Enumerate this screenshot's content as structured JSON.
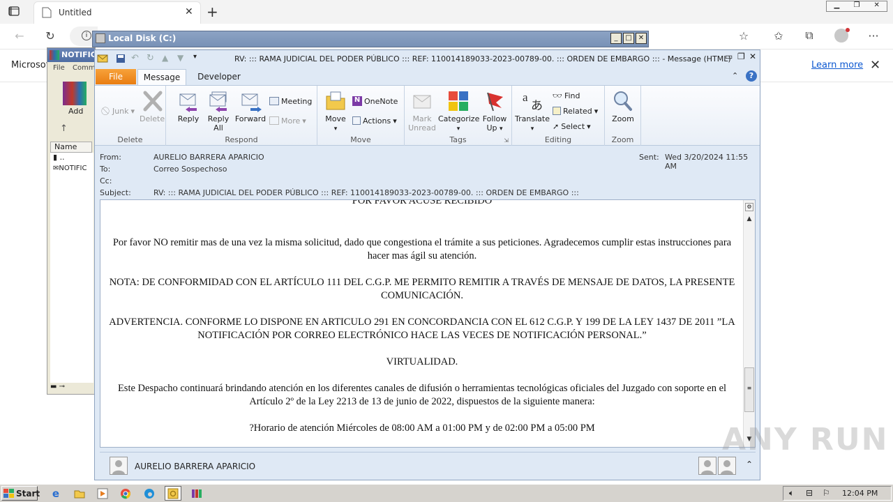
{
  "browser": {
    "tab_title": "Untitled",
    "infobar_text": "Microsoft",
    "learn_more": "Learn more"
  },
  "explorer": {
    "title": "Local Disk (C:)"
  },
  "winrar": {
    "title": "NOTIFIC",
    "menu_file": "File",
    "menu_commands": "Comm",
    "add_label": "Add",
    "col_name": "Name",
    "row_up": "..",
    "row_file": "NOTIFIC"
  },
  "outlook": {
    "title": "RV: ::: RAMA JUDICIAL DEL PODER PÚBLICO ::: REF: 110014189033-2023-00789-00. ::: ORDEN DE EMBARGO ::: -  Message (HTML)",
    "tabs": [
      "File",
      "Message",
      "Developer"
    ],
    "groups": {
      "delete": {
        "label": "Delete",
        "junk": "Junk",
        "delete": "Delete"
      },
      "respond": {
        "label": "Respond",
        "reply": "Reply",
        "reply_all_1": "Reply",
        "reply_all_2": "All",
        "forward": "Forward",
        "meeting": "Meeting",
        "more": "More"
      },
      "move": {
        "label": "Move",
        "move": "Move",
        "onenote": "OneNote",
        "actions": "Actions"
      },
      "tags": {
        "label": "Tags",
        "mark_1": "Mark",
        "mark_2": "Unread",
        "categorize": "Categorize",
        "follow_1": "Follow",
        "follow_2": "Up"
      },
      "editing": {
        "label": "Editing",
        "translate": "Translate",
        "find": "Find",
        "related": "Related",
        "select": "Select"
      },
      "zoom": {
        "label": "Zoom",
        "zoom": "Zoom"
      }
    },
    "header": {
      "from_label": "From:",
      "from": "AURELIO  BARRERA APARICIO",
      "to_label": "To:",
      "to": "Correo Sospechoso",
      "cc_label": "Cc:",
      "subject_label": "Subject:",
      "subject": "RV: ::: RAMA JUDICIAL DEL PODER PÚBLICO ::: REF: 110014189033-2023-00789-00. ::: ORDEN DE EMBARGO :::",
      "sent_label": "Sent:",
      "sent": "Wed 3/20/2024 11:55 AM"
    },
    "body": {
      "p0": "POR FAVOR ACUSE RECIBIDO",
      "p1": "Por favor NO remitir mas de una vez la misma solicitud, dado que congestiona el trámite a sus peticiones. Agradecemos cumplir estas instrucciones para hacer mas ágil su atención.",
      "p2": "NOTA: DE CONFORMIDAD CON EL ARTÍCULO 111 DEL C.G.P. ME PERMITO REMITIR A TRAVÉS DE MENSAJE DE DATOS, LA PRESENTE COMUNICACIÓN.",
      "p3": "ADVERTENCIA. CONFORME LO DISPONE EN ARTICULO 291 EN CONCORDANCIA CON EL 612 C.G.P. Y 199 DE LA LEY 1437 DE 2011 ”LA NOTIFICACIÓN POR CORREO ELECTRÓNICO HACE LAS VECES DE NOTIFICACIÓN PERSONAL.”",
      "p4": "VIRTUALIDAD.",
      "p5": "Este Despacho continuará brindando atención en los diferentes canales de difusión o herramientas tecnológicas oficiales del Juzgado con soporte en el Artículo 2º de la Ley 2213 de 13 de junio de 2022, dispuestos de la siguiente manera:",
      "p6": "?Horario de atención Miércoles de 08:00 AM a 01:00 PM y de 02:00 PM a 05:00 PM"
    },
    "people_pane": "AURELIO  BARRERA APARICIO"
  },
  "taskbar": {
    "start": "Start",
    "clock": "12:04 PM"
  },
  "watermark": "ANY RUN"
}
